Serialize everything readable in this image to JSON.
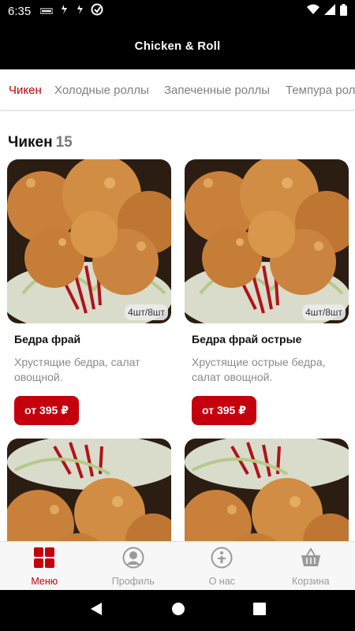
{
  "status_bar": {
    "time": "6:35"
  },
  "header": {
    "title": "Chicken & Roll"
  },
  "tabs": [
    {
      "label": "Чикен",
      "active": true
    },
    {
      "label": "Холодные роллы",
      "active": false
    },
    {
      "label": "Запеченные роллы",
      "active": false
    },
    {
      "label": "Темпура роллы",
      "active": false
    }
  ],
  "section": {
    "title": "Чикен",
    "count": "15"
  },
  "products": [
    {
      "name": "Бедра фрай",
      "description": "Хрустящие бедра, салат овощной.",
      "badge": "4шт/8шт",
      "price": "от 395 ₽"
    },
    {
      "name": "Бедра фрай острые",
      "description": "Хрустящие острые бедра, салат овощной.",
      "badge": "4шт/8шт",
      "price": "от 395 ₽"
    }
  ],
  "bottom_nav": [
    {
      "label": "Меню",
      "icon": "grid-icon",
      "active": true
    },
    {
      "label": "Профиль",
      "icon": "profile-icon",
      "active": false
    },
    {
      "label": "О нас",
      "icon": "info-icon",
      "active": false
    },
    {
      "label": "Корзина",
      "icon": "basket-icon",
      "active": false
    }
  ],
  "colors": {
    "accent": "#c4000d",
    "header_bg": "#000000",
    "inactive": "#9a9a9a"
  }
}
